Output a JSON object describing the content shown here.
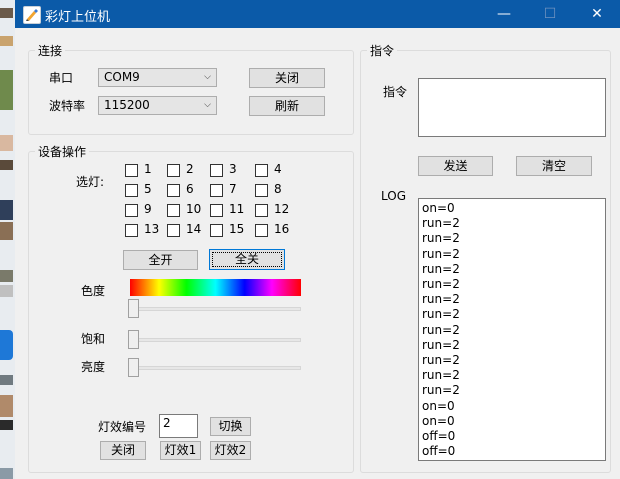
{
  "window": {
    "title": "彩灯上位机",
    "minimize": "—",
    "maximize": "☐",
    "close": "✕"
  },
  "connection": {
    "legend": "连接",
    "port_label": "串口",
    "port_value": "COM9",
    "baud_label": "波特率",
    "baud_value": "115200",
    "close_button": "关闭",
    "refresh_button": "刷新"
  },
  "device": {
    "legend": "设备操作",
    "select_label": "选灯:",
    "lights": [
      "1",
      "2",
      "3",
      "4",
      "5",
      "6",
      "7",
      "8",
      "9",
      "10",
      "11",
      "12",
      "13",
      "14",
      "15",
      "16"
    ],
    "all_on": "全开",
    "all_off": "全关",
    "hue_label": "色度",
    "saturation_label": "饱和",
    "brightness_label": "亮度",
    "hue_value": 0,
    "saturation_value": 0,
    "brightness_value": 0,
    "effect_label": "灯效编号",
    "effect_value": "2",
    "switch_button": "切换",
    "close_button": "关闭",
    "effect1_button": "灯效1",
    "effect2_button": "灯效2"
  },
  "command": {
    "legend": "指令",
    "label": "指令",
    "value": "",
    "send_button": "发送",
    "clear_button": "清空",
    "log_label": "LOG",
    "log": [
      "on=0",
      "run=2",
      "run=2",
      "run=2",
      "run=2",
      "run=2",
      "run=2",
      "run=2",
      "run=2",
      "run=2",
      "run=2",
      "run=2",
      "run=2",
      "on=0",
      "on=0",
      "off=0",
      "off=0"
    ]
  }
}
